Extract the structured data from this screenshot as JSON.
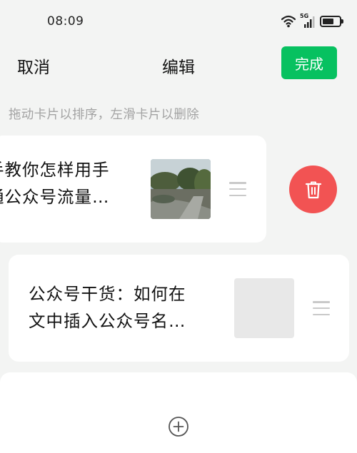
{
  "status_bar": {
    "time": "08:09",
    "network_label": "5G",
    "icons": [
      "wifi-icon",
      "cellular-signal-icon",
      "battery-icon"
    ]
  },
  "nav": {
    "cancel_label": "取消",
    "title": "编辑",
    "done_label": "完成"
  },
  "hint": "拖动卡片以排序，左滑卡片以删除",
  "articles": [
    {
      "title_line1": "手教你怎样用手",
      "title_line2": "通公众号流量…",
      "thumbnail": "landscape-photo",
      "drag_icon": "drag-handle-icon"
    },
    {
      "title_line1": "公众号干货：如何在",
      "title_line2": "文中插入公众号名…",
      "thumbnail": "empty",
      "drag_icon": "drag-handle-icon"
    }
  ],
  "delete_icon": "trash-icon",
  "add_icon": "plus-circle-icon",
  "colors": {
    "accent": "#07c160",
    "delete": "#f25353",
    "background": "#f3f4f3",
    "hint_text": "#a3a3a3"
  }
}
